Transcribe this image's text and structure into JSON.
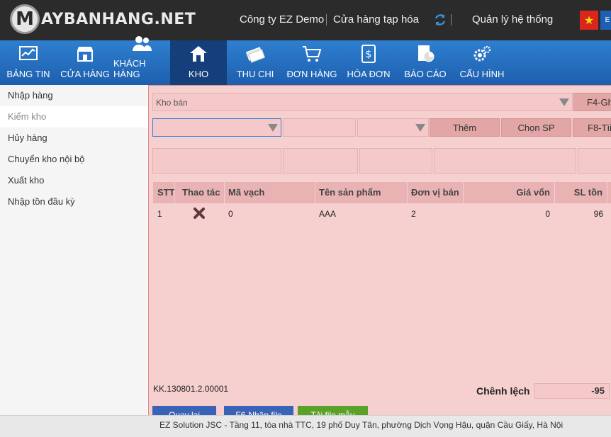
{
  "header": {
    "logo_mark": "M",
    "logo_text": "AYBANHANG.NET",
    "company": "Công ty EZ Demo",
    "store": "Cửa hàng tạp hóa",
    "admin": "Quản lý hệ thống",
    "lang_en": "E"
  },
  "nav": {
    "items": [
      {
        "label": "BẢNG TIN",
        "icon": "dashboard-icon"
      },
      {
        "label": "CỬA HÀNG",
        "icon": "store-icon"
      },
      {
        "label": "KHÁCH HÀNG",
        "icon": "customers-icon"
      },
      {
        "label": "KHO",
        "icon": "warehouse-icon"
      },
      {
        "label": "THU CHI",
        "icon": "money-icon"
      },
      {
        "label": "ĐƠN HÀNG",
        "icon": "cart-icon"
      },
      {
        "label": "HÓA ĐƠN",
        "icon": "invoice-icon"
      },
      {
        "label": "BÁO CÁO",
        "icon": "report-icon"
      },
      {
        "label": "CẤU HÌNH",
        "icon": "settings-icon"
      }
    ],
    "active": "KHO"
  },
  "sidebar": {
    "items": [
      {
        "label": "Nhập hàng"
      },
      {
        "label": "Kiểm kho"
      },
      {
        "label": "Hủy hàng"
      },
      {
        "label": "Chuyển kho nội bộ"
      },
      {
        "label": "Xuất kho"
      },
      {
        "label": "Nhập tồn đầu kỳ"
      }
    ],
    "active": "Kiểm kho"
  },
  "form": {
    "warehouse_select": "Kho bán",
    "f4_button": "F4-Gh",
    "add_button": "Thêm",
    "choose_button": "Chọn SP",
    "f8_button": "F8-Tìi"
  },
  "table": {
    "headers": [
      "STT",
      "Thao tác",
      "Mã vạch",
      "Tên sản phẩm",
      "Đơn vị bán",
      "Giá vốn",
      "SL tồn"
    ],
    "rows": [
      {
        "stt": "1",
        "barcode": "0",
        "name": "AAA",
        "unit": "2",
        "cost": "0",
        "stock": "96"
      }
    ]
  },
  "summary": {
    "doc_code": "KK.130801.2.00001",
    "diff_label": "Chênh lệch",
    "diff_value": "-95"
  },
  "bottom_buttons": {
    "back": "Quay lại",
    "import": "F6-Nhập file",
    "download": "Tải file mẫu"
  },
  "footer": {
    "text": "EZ Solution JSC - Tầng 11, tòa nhà TTC, 19 phố Duy Tân, phường Dịch Vọng Hậu, quận Cầu Giấy, Hà Nội"
  },
  "colors": {
    "nav_blue": "#2f7fd0",
    "nav_active": "#143f7a",
    "panel_pink": "#f6cfcf",
    "button_blue": "#3a63b8",
    "button_green": "#5aa12a"
  }
}
